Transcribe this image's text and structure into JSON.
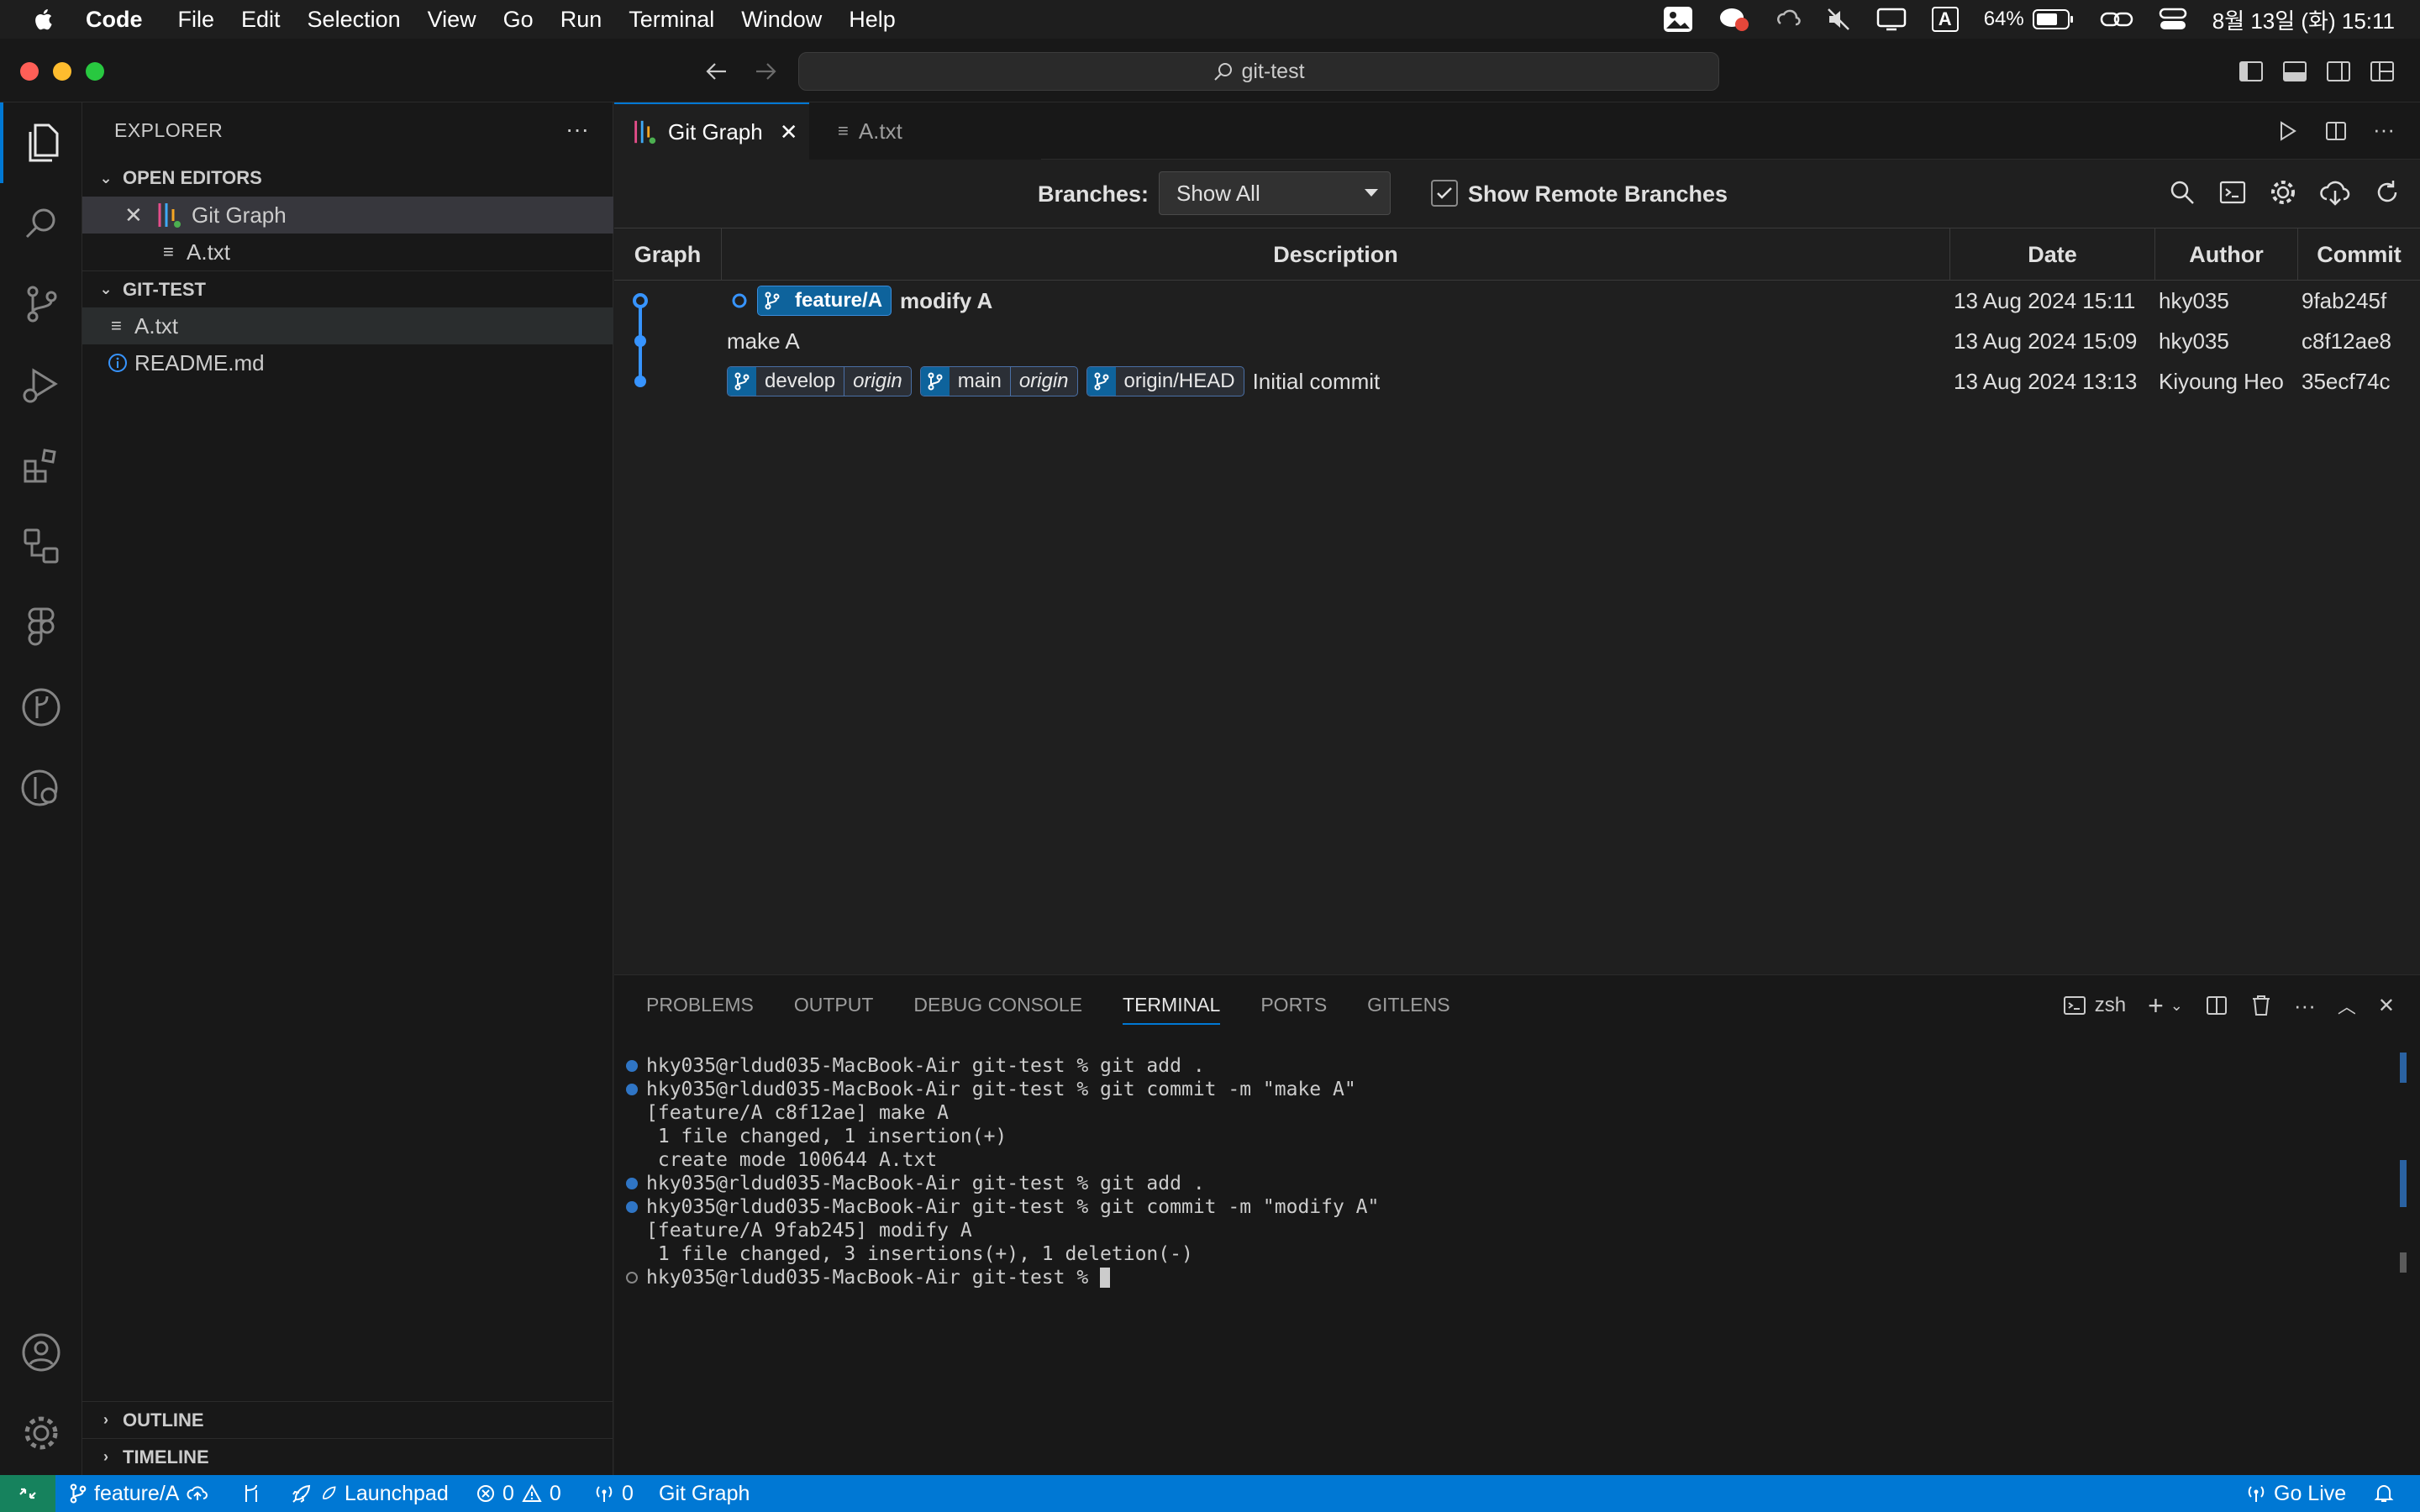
{
  "menubar": {
    "app": "Code",
    "items": [
      "File",
      "Edit",
      "Selection",
      "View",
      "Go",
      "Run",
      "Terminal",
      "Window",
      "Help"
    ],
    "battery": "64%",
    "input_indicator": "A",
    "datetime": "8월 13일 (화) 15:11"
  },
  "titlebar": {
    "search": "git-test"
  },
  "sidebar": {
    "title": "EXPLORER",
    "open_editors": {
      "header": "OPEN EDITORS",
      "items": [
        "Git Graph",
        "A.txt"
      ]
    },
    "folder": {
      "header": "GIT-TEST",
      "items": [
        "A.txt",
        "README.md"
      ]
    },
    "outline": "OUTLINE",
    "timeline": "TIMELINE"
  },
  "tabs": [
    {
      "label": "Git Graph"
    },
    {
      "label": "A.txt"
    }
  ],
  "gitgraph": {
    "branches_label": "Branches:",
    "branches_value": "Show All",
    "remote_label": "Show Remote Branches",
    "columns": [
      "Graph",
      "Description",
      "Date",
      "Author",
      "Commit"
    ],
    "rows": [
      {
        "refs": [
          {
            "name": "feature/A",
            "head": true
          }
        ],
        "message": "modify A",
        "date": "13 Aug 2024 15:11",
        "author": "hky035",
        "commit": "9fab245f"
      },
      {
        "refs": [],
        "message": "make A",
        "date": "13 Aug 2024 15:09",
        "author": "hky035",
        "commit": "c8f12ae8"
      },
      {
        "refs": [
          {
            "name": "develop",
            "remote": "origin"
          },
          {
            "name": "main",
            "remote": "origin"
          },
          {
            "name": "origin/HEAD"
          }
        ],
        "message": "Initial commit",
        "date": "13 Aug 2024 13:13",
        "author": "Kiyoung Heo",
        "commit": "35ecf74c"
      }
    ]
  },
  "panel": {
    "tabs": [
      "PROBLEMS",
      "OUTPUT",
      "DEBUG CONSOLE",
      "TERMINAL",
      "PORTS",
      "GITLENS"
    ],
    "active_tab": "TERMINAL",
    "shell": "zsh",
    "terminal_lines": [
      {
        "dot": "filled",
        "text": "hky035@rldud035-MacBook-Air git-test % git add ."
      },
      {
        "dot": "filled",
        "text": "hky035@rldud035-MacBook-Air git-test % git commit -m \"make A\""
      },
      {
        "dot": "none",
        "text": "[feature/A c8f12ae] make A"
      },
      {
        "dot": "none",
        "text": " 1 file changed, 1 insertion(+)"
      },
      {
        "dot": "none",
        "text": " create mode 100644 A.txt"
      },
      {
        "dot": "filled",
        "text": "hky035@rldud035-MacBook-Air git-test % git add ."
      },
      {
        "dot": "filled",
        "text": "hky035@rldud035-MacBook-Air git-test % git commit -m \"modify A\""
      },
      {
        "dot": "none",
        "text": "[feature/A 9fab245] modify A"
      },
      {
        "dot": "none",
        "text": " 1 file changed, 3 insertions(+), 1 deletion(-)"
      },
      {
        "dot": "hollow",
        "text": "hky035@rldud035-MacBook-Air git-test % "
      }
    ]
  },
  "statusbar": {
    "branch": "feature/A",
    "launchpad": "Launchpad",
    "errors": "0",
    "warnings": "0",
    "ports": "0",
    "gitgraph": "Git Graph",
    "golive": "Go Live"
  }
}
